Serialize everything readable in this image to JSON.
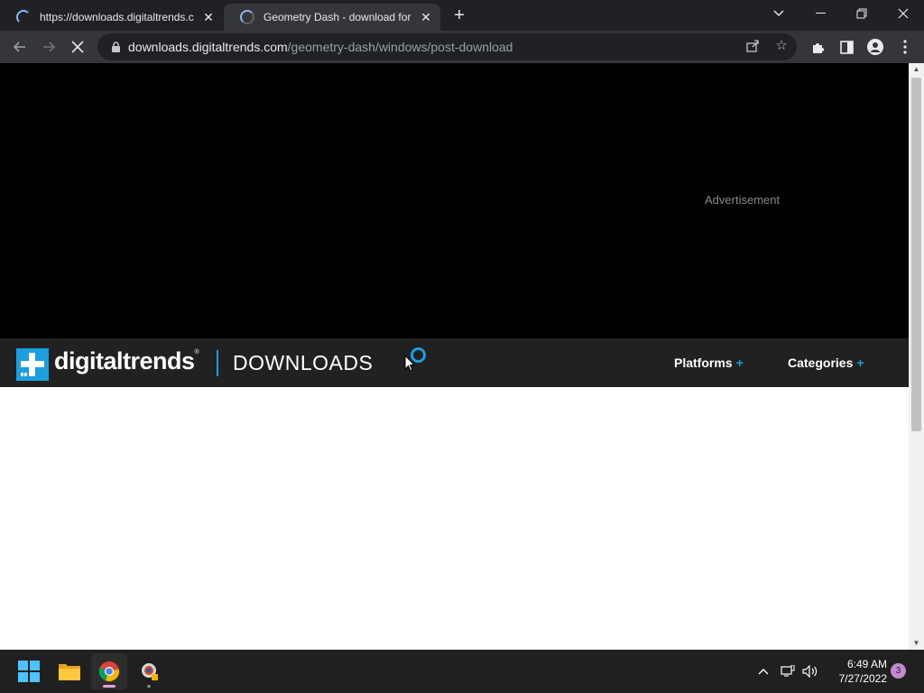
{
  "browser": {
    "tabs": [
      {
        "title": "https://downloads.digitaltrends.c",
        "active": false,
        "loading": true
      },
      {
        "title": "Geometry Dash - download for W",
        "active": true,
        "loading": true
      }
    ],
    "address": {
      "host": "downloads.digitaltrends.com",
      "path": "/geometry-dash/windows/post-download"
    }
  },
  "page": {
    "ad_label": "Advertisement",
    "logo_text": "digitaltrends",
    "logo_mark": "®",
    "section_title": "DOWNLOADS",
    "nav": [
      {
        "label": "Platforms",
        "suffix": "+"
      },
      {
        "label": "Categories",
        "suffix": "+"
      }
    ],
    "accent_color": "#1a9fe0"
  },
  "taskbar": {
    "apps": [
      "windows-start",
      "file-explorer",
      "chrome",
      "app-shortcut"
    ],
    "clock": {
      "time": "6:49 AM",
      "date": "7/27/2022"
    },
    "notification_count": "3"
  }
}
